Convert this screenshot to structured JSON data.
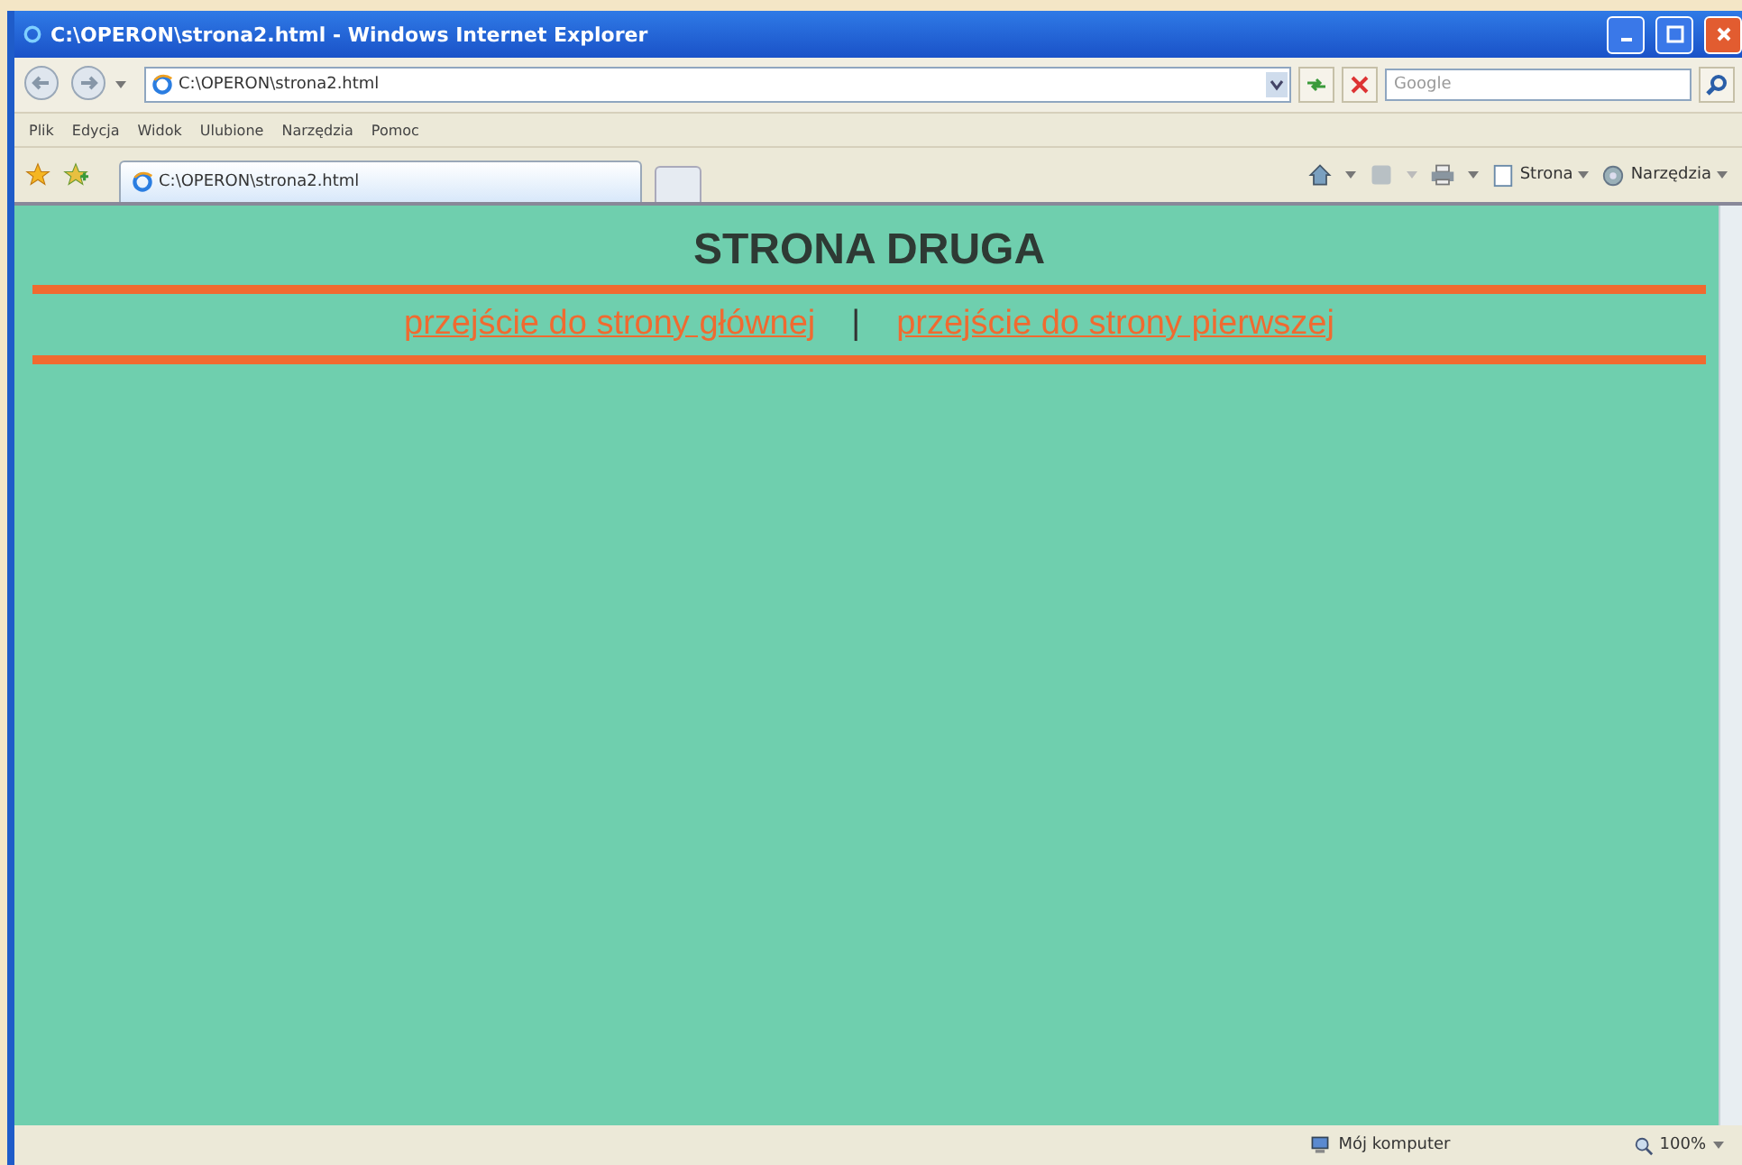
{
  "window": {
    "title": "C:\\OPERON\\strona2.html - Windows Internet Explorer"
  },
  "address_bar": {
    "value": "C:\\OPERON\\strona2.html"
  },
  "search": {
    "placeholder": "Google"
  },
  "menu": [
    "Plik",
    "Edycja",
    "Widok",
    "Ulubione",
    "Narzędzia",
    "Pomoc"
  ],
  "tabs": [
    {
      "label": "C:\\OPERON\\strona2.html",
      "selected": true
    }
  ],
  "command_bar": [
    "Strona",
    "Narzędzia"
  ],
  "page": {
    "heading": "STRONA DRUGA",
    "links": [
      "przejście do strony głównej",
      "przejście do strony pierwszej"
    ],
    "separator": "|"
  },
  "status_bar": {
    "zone": "Mój komputer",
    "zoom": "100%"
  }
}
